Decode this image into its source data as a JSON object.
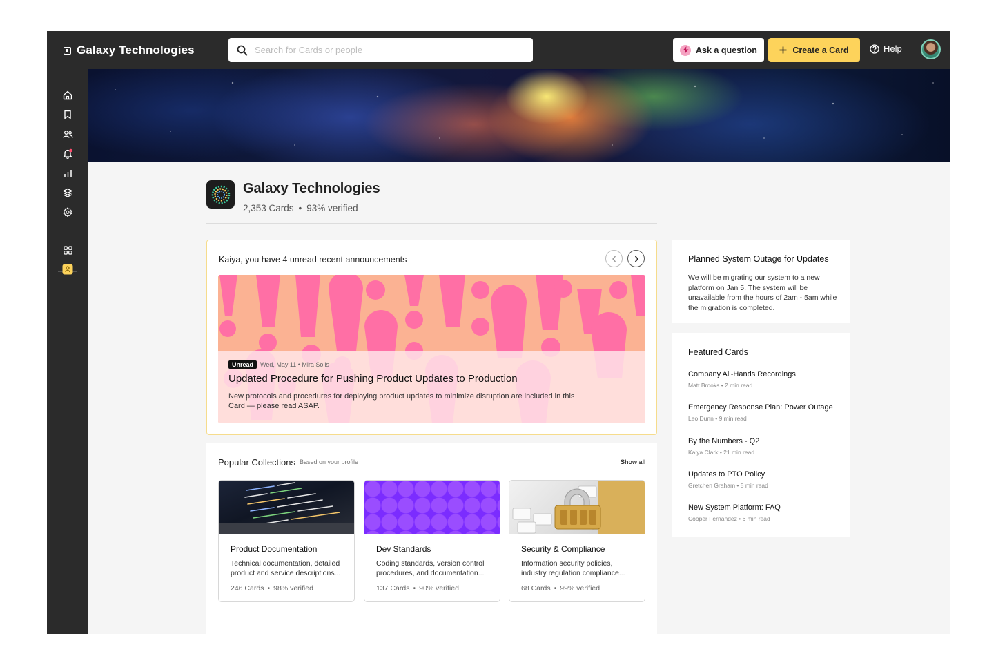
{
  "brand": {
    "name": "Galaxy Technologies"
  },
  "search": {
    "placeholder": "Search for Cards or people"
  },
  "header": {
    "ask_label": "Ask a question",
    "create_label": "Create a Card",
    "help_label": "Help"
  },
  "sidebar": {
    "icons": [
      "home-icon",
      "bookmark-icon",
      "people-icon",
      "bell-icon",
      "analytics-icon",
      "layers-icon",
      "settings-icon",
      "apps-grid-icon",
      "integration-icon"
    ]
  },
  "company": {
    "name": "Galaxy Technologies",
    "cards": "2,353 Cards",
    "verified": "93% verified"
  },
  "announcement": {
    "title": "Kaiya, you have 4 unread recent announcements",
    "badge": "Unread",
    "meta": "Wed, May 11 • Mira Solis",
    "headline": "Updated Procedure for Pushing Product Updates to Production",
    "body": "New protocols and procedures for deploying product updates to minimize disruption are included in this Card — please read ASAP."
  },
  "popular": {
    "title": "Popular Collections",
    "subtitle": "Based on your profile",
    "show_all": "Show all",
    "collections": [
      {
        "name": "Product Documentation",
        "desc1": "Technical documentation, detailed",
        "desc2": "product and service descriptions...",
        "cards": "246 Cards",
        "verified": "98% verified"
      },
      {
        "name": "Dev Standards",
        "desc1": "Coding standards, version control",
        "desc2": "procedures, and documentation...",
        "cards": "137 Cards",
        "verified": "90% verified"
      },
      {
        "name": "Security & Compliance",
        "desc1": "Information security policies,",
        "desc2": "industry regulation compliance...",
        "cards": "68 Cards",
        "verified": "99% verified"
      }
    ]
  },
  "outage": {
    "title": "Planned System Outage for Updates",
    "body": "We will be migrating our system to a new platform on Jan 5. The system will be unavailable from the hours of 2am - 5am while the migration is completed."
  },
  "featured": {
    "title": "Featured Cards",
    "items": [
      {
        "title": "Company All-Hands Recordings",
        "meta": "Matt Brooks • 2 min read"
      },
      {
        "title": "Emergency Response Plan: Power Outage",
        "meta": "Leo Dunn • 9 min read"
      },
      {
        "title": "By the Numbers - Q2",
        "meta": "Kaiya Clark • 21 min read"
      },
      {
        "title": "Updates to PTO Policy",
        "meta": "Gretchen Graham • 5 min read"
      },
      {
        "title": "New System Platform: FAQ",
        "meta": "Cooper Fernandez • 6 min read"
      }
    ]
  },
  "colors": {
    "accent": "#fdd35b",
    "chrome": "#2b2b2b",
    "announcement_border": "#f6dc8c",
    "pink": "#ff6fa5",
    "notification_dot": "#ff4d6d"
  }
}
